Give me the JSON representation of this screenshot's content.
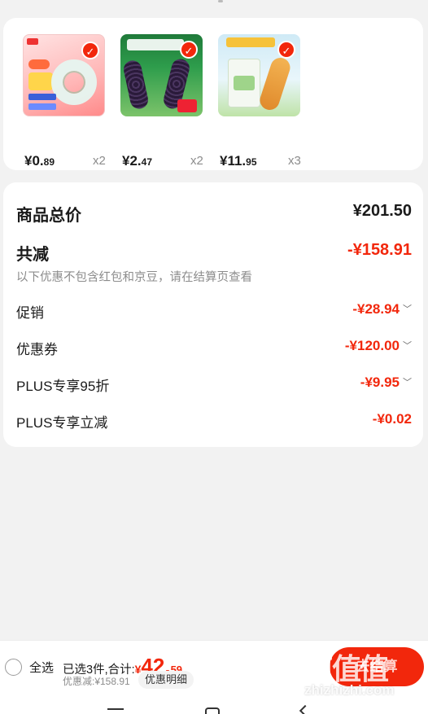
{
  "products": [
    {
      "price_int": "¥0.",
      "price_cents": "89",
      "qty": "x2",
      "thumb": "tape-product-image"
    },
    {
      "price_int": "¥2.",
      "price_cents": "47",
      "qty": "x2",
      "thumb": "black-corn-product-image"
    },
    {
      "price_int": "¥11.",
      "price_cents": "95",
      "qty": "x3",
      "thumb": "corn-flour-product-image"
    }
  ],
  "summary": {
    "total_label": "商品总价",
    "total_value": "¥201.50",
    "discount_label": "共减",
    "discount_value": "-¥158.91",
    "note": "以下优惠不包含红包和京豆，请在结算页查看",
    "rows": [
      {
        "label": "促销",
        "value": "-¥28.94",
        "chevron": "chevron-down-icon"
      },
      {
        "label": "优惠券",
        "value": "-¥120.00",
        "chevron": "chevron-down-icon"
      },
      {
        "label": "PLUS专享95折",
        "value": "-¥9.95",
        "chevron": "chevron-down-icon"
      },
      {
        "label": "PLUS专享立减",
        "value": "-¥0.02"
      }
    ]
  },
  "bottom_bar": {
    "select_all": "全选",
    "selected_text": "已选3件,合计:",
    "currency": "¥",
    "amount_int": "42.",
    "amount_cents": "59",
    "discount_text": "优惠减:¥158.91",
    "detail_label": "优惠明细",
    "checkout_label": "去结算"
  },
  "watermark": {
    "text": "zhizhizhi.com",
    "mark": "值值值"
  },
  "colors": {
    "accent": "#f2270c",
    "background": "#f2f2f2",
    "muted": "#8c8c8c"
  }
}
